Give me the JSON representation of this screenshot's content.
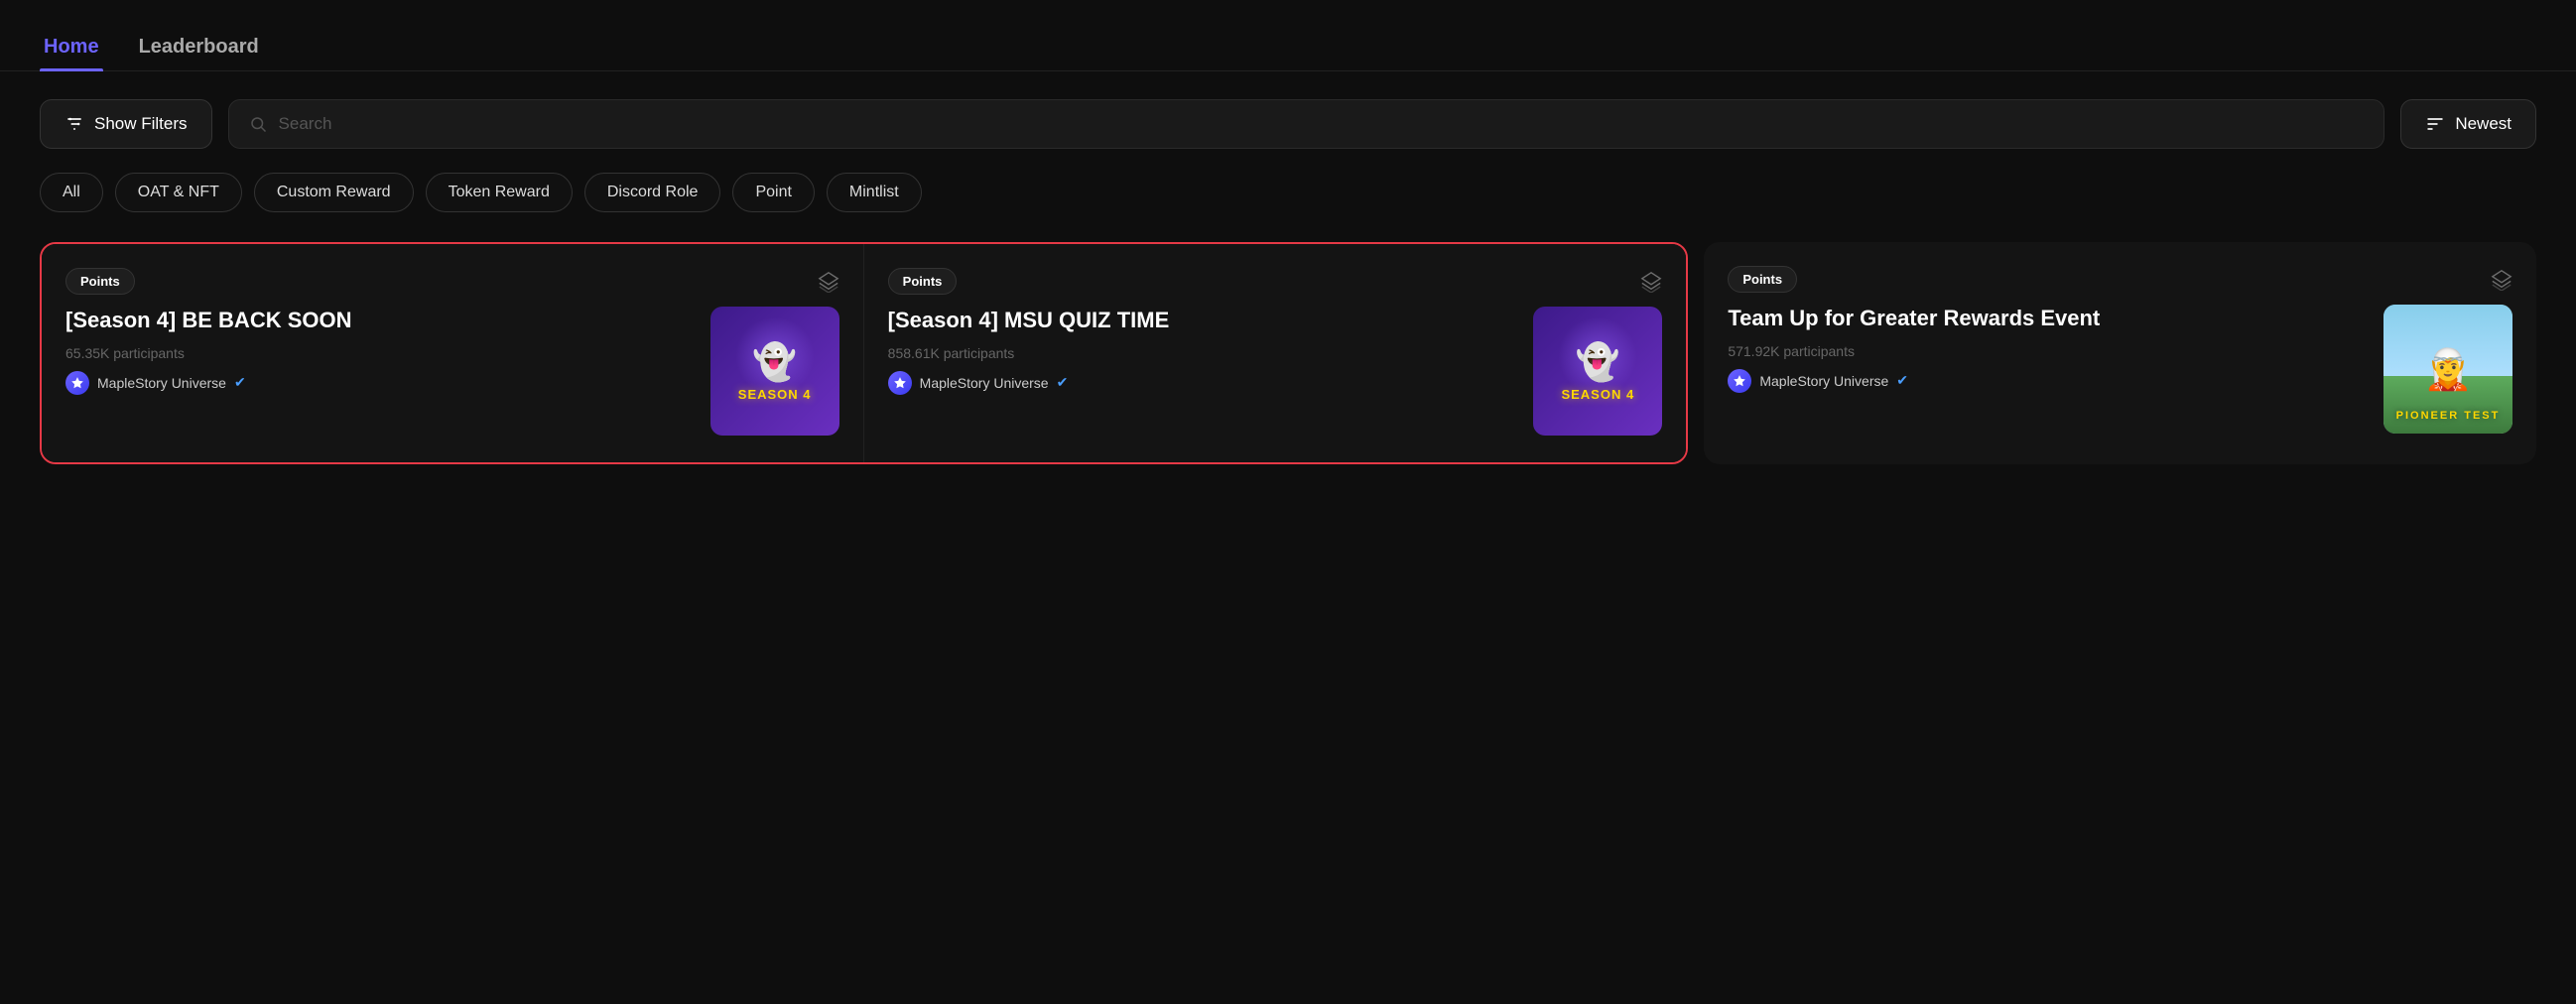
{
  "nav": {
    "items": [
      {
        "label": "Home",
        "active": true
      },
      {
        "label": "Leaderboard",
        "active": false
      }
    ]
  },
  "toolbar": {
    "show_filters_label": "Show Filters",
    "search_placeholder": "Search",
    "sort_label": "Newest"
  },
  "filter_tags": [
    {
      "label": "All",
      "active": false
    },
    {
      "label": "OAT & NFT",
      "active": false
    },
    {
      "label": "Custom Reward",
      "active": false
    },
    {
      "label": "Token Reward",
      "active": false
    },
    {
      "label": "Discord Role",
      "active": false
    },
    {
      "label": "Point",
      "active": false
    },
    {
      "label": "Mintlist",
      "active": false
    }
  ],
  "cards": [
    {
      "badge": "Points",
      "title": "[Season 4] BE BACK SOON",
      "participants": "65.35K participants",
      "author": "MapleStory Universe",
      "verified": true,
      "image_type": "season4",
      "highlighted": true
    },
    {
      "badge": "Points",
      "title": "[Season 4] MSU QUIZ TIME",
      "participants": "858.61K participants",
      "author": "MapleStory Universe",
      "verified": true,
      "image_type": "season4",
      "highlighted": true
    },
    {
      "badge": "Points",
      "title": "Team Up for Greater Rewards Event",
      "participants": "571.92K participants",
      "author": "MapleStory Universe",
      "verified": true,
      "image_type": "pioneer",
      "highlighted": false
    }
  ]
}
